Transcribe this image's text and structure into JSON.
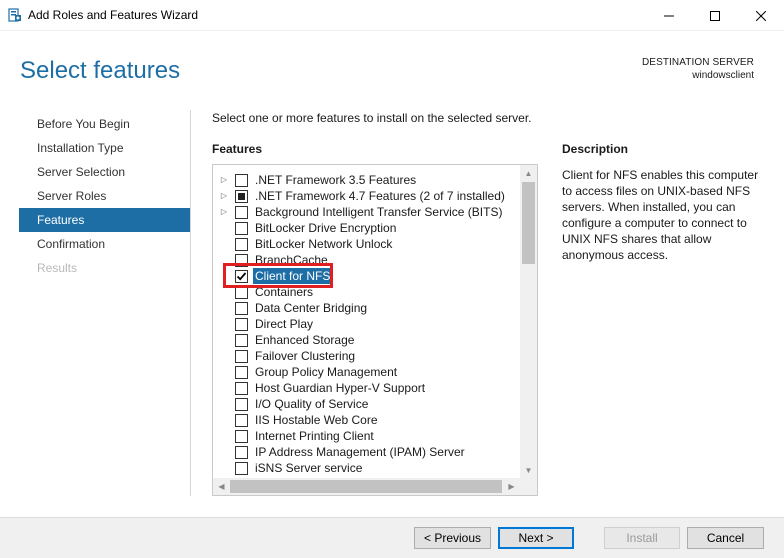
{
  "window": {
    "title": "Add Roles and Features Wizard",
    "icon": "server-manager-icon"
  },
  "header": {
    "title": "Select features",
    "destination_label": "DESTINATION SERVER",
    "destination_value": "windowsclient"
  },
  "nav": {
    "items": [
      {
        "label": "Before You Begin",
        "state": "normal"
      },
      {
        "label": "Installation Type",
        "state": "normal"
      },
      {
        "label": "Server Selection",
        "state": "normal"
      },
      {
        "label": "Server Roles",
        "state": "normal"
      },
      {
        "label": "Features",
        "state": "active"
      },
      {
        "label": "Confirmation",
        "state": "normal"
      },
      {
        "label": "Results",
        "state": "disabled"
      }
    ]
  },
  "main": {
    "instruction": "Select one or more features to install on the selected server.",
    "features_heading": "Features",
    "features": [
      {
        "label": ".NET Framework 3.5 Features",
        "expandable": true,
        "state": "unchecked"
      },
      {
        "label": ".NET Framework 4.7 Features (2 of 7 installed)",
        "expandable": true,
        "state": "partial"
      },
      {
        "label": "Background Intelligent Transfer Service (BITS)",
        "expandable": true,
        "state": "unchecked"
      },
      {
        "label": "BitLocker Drive Encryption",
        "expandable": false,
        "state": "unchecked"
      },
      {
        "label": "BitLocker Network Unlock",
        "expandable": false,
        "state": "unchecked"
      },
      {
        "label": "BranchCache",
        "expandable": false,
        "state": "unchecked"
      },
      {
        "label": "Client for NFS",
        "expandable": false,
        "state": "checked",
        "selected": true
      },
      {
        "label": "Containers",
        "expandable": false,
        "state": "unchecked"
      },
      {
        "label": "Data Center Bridging",
        "expandable": false,
        "state": "unchecked"
      },
      {
        "label": "Direct Play",
        "expandable": false,
        "state": "unchecked"
      },
      {
        "label": "Enhanced Storage",
        "expandable": false,
        "state": "unchecked"
      },
      {
        "label": "Failover Clustering",
        "expandable": false,
        "state": "unchecked"
      },
      {
        "label": "Group Policy Management",
        "expandable": false,
        "state": "unchecked"
      },
      {
        "label": "Host Guardian Hyper-V Support",
        "expandable": false,
        "state": "unchecked"
      },
      {
        "label": "I/O Quality of Service",
        "expandable": false,
        "state": "unchecked"
      },
      {
        "label": "IIS Hostable Web Core",
        "expandable": false,
        "state": "unchecked"
      },
      {
        "label": "Internet Printing Client",
        "expandable": false,
        "state": "unchecked"
      },
      {
        "label": "IP Address Management (IPAM) Server",
        "expandable": false,
        "state": "unchecked"
      },
      {
        "label": "iSNS Server service",
        "expandable": false,
        "state": "unchecked"
      }
    ]
  },
  "description": {
    "heading": "Description",
    "text": "Client for NFS enables this computer to access files on UNIX-based NFS servers. When installed, you can configure a computer to connect to UNIX NFS shares that allow anonymous access."
  },
  "footer": {
    "previous_label": "< Previous",
    "next_label": "Next >",
    "install_label": "Install",
    "cancel_label": "Cancel"
  },
  "colors": {
    "accent": "#1e6ea6",
    "highlight_box": "#e02020"
  }
}
